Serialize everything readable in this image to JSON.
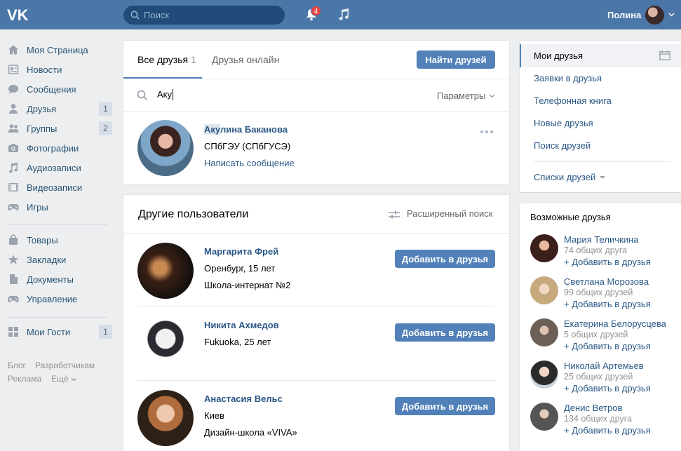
{
  "header": {
    "logo": "VK",
    "search_placeholder": "Поиск",
    "notifications_count": "4",
    "user_name": "Полина",
    "icons": [
      "vk-logo-icon",
      "search-icon",
      "bell-icon",
      "music-icon",
      "chevron-down-icon"
    ]
  },
  "left_menu": {
    "items": [
      {
        "label": "Моя Страница",
        "icon": "home-icon"
      },
      {
        "label": "Новости",
        "icon": "news-icon"
      },
      {
        "label": "Сообщения",
        "icon": "messages-icon"
      },
      {
        "label": "Друзья",
        "icon": "person-icon",
        "count": "1"
      },
      {
        "label": "Группы",
        "icon": "groups-icon",
        "count": "2"
      },
      {
        "label": "Фотографии",
        "icon": "camera-icon"
      },
      {
        "label": "Аудиозаписи",
        "icon": "music-icon"
      },
      {
        "label": "Видеозаписи",
        "icon": "video-icon"
      },
      {
        "label": "Игры",
        "icon": "gamepad-icon"
      },
      {
        "label": "Товары",
        "icon": "bag-icon"
      },
      {
        "label": "Закладки",
        "icon": "star-icon"
      },
      {
        "label": "Документы",
        "icon": "document-icon"
      },
      {
        "label": "Управление",
        "icon": "gamepad-icon"
      },
      {
        "label": "Мои Гости",
        "icon": "grid-icon",
        "count": "1"
      }
    ],
    "footer": [
      "Блог",
      "Разработчикам",
      "Реклама",
      "Ещё"
    ]
  },
  "friends_panel": {
    "tab_all": "Все друзья",
    "tab_all_count": "1",
    "tab_online": "Друзья онлайн",
    "find_button": "Найти друзей",
    "search_value": "Аку",
    "params_label": "Параметры",
    "result": {
      "name_highlight": "Аку",
      "name_rest": "лина Баканова",
      "line1": "СПбГЭУ (СПбГУСЭ)",
      "message_link": "Написать сообщение"
    }
  },
  "others_panel": {
    "title": "Другие пользователи",
    "advanced_search": "Расширенный поиск",
    "add_label": "Добавить в друзья",
    "people": [
      {
        "name": "Маргарита Фрей",
        "line1": "Оренбург, 15 лет",
        "line2": "Школа-интернат №2"
      },
      {
        "name": "Никита Ахмедов",
        "line1": "Fukuoka, 25 лет",
        "line2": ""
      },
      {
        "name": "Анастасия Вельс",
        "line1": "Киев",
        "line2": "Дизайн-школа «VIVA»"
      }
    ]
  },
  "right_nav": {
    "items": [
      "Мои друзья",
      "Заявки в друзья",
      "Телефонная книга",
      "Новые друзья",
      "Поиск друзей"
    ],
    "lists": "Списки друзей"
  },
  "possible_friends": {
    "title": "Возможные друзья",
    "add_label": "+ Добавить в друзья",
    "people": [
      {
        "name": "Мария Теличкина",
        "mutual": "74 общих друга"
      },
      {
        "name": "Светлана Морозова",
        "mutual": "99 общих друзей"
      },
      {
        "name": "Екатерина Белорусцева",
        "mutual": "5 общих друзей"
      },
      {
        "name": "Николай Артемьев",
        "mutual": "25 общих друзей"
      },
      {
        "name": "Денис Ветров",
        "mutual": "134 общих друга"
      }
    ]
  },
  "colors": {
    "header": "#4a76a8",
    "accent": "#5181b8",
    "link": "#2a5885",
    "background": "#edeef0"
  }
}
